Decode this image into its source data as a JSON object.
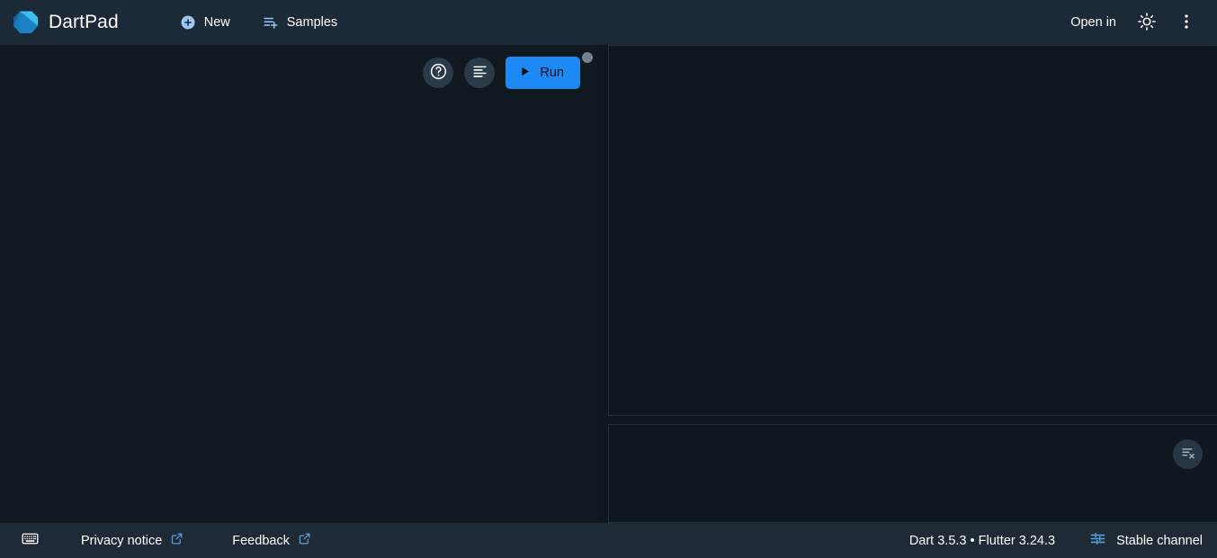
{
  "app": {
    "title": "DartPad",
    "logo_icon": "dart-logo-icon",
    "accent_blue": "#1d89f5",
    "topbar_bg": "#1c2936",
    "editor_bg": "#101820",
    "panel_bg": "#0f1720",
    "statusbar_bg": "#1e2b37"
  },
  "topbar": {
    "nav": [
      {
        "label": "New",
        "icon": "add-circle-icon"
      },
      {
        "label": "Samples",
        "icon": "playlist-add-icon"
      }
    ],
    "open_in": {
      "label": "Open in",
      "icon": "download-icon"
    },
    "theme_toggle": {
      "icon": "brightness-sun-icon",
      "label": ""
    },
    "overflow_menu": {
      "icon": "more-vert-icon",
      "label": ""
    }
  },
  "editor": {
    "toolbar": {
      "help": {
        "icon": "help-circle-icon",
        "label": ""
      },
      "format": {
        "icon": "format-align-icon",
        "label": ""
      },
      "run": {
        "label": "Run",
        "icon": "play-arrow-icon"
      },
      "status_indicator": {
        "icon": "status-dot-icon",
        "color": "#76818c"
      }
    },
    "content": ""
  },
  "preview": {
    "content": ""
  },
  "console": {
    "content": "",
    "clear_button": {
      "icon": "format-clear-icon",
      "label": ""
    }
  },
  "statusbar": {
    "keyboard_shortcuts": {
      "icon": "keyboard-icon",
      "label": ""
    },
    "links": [
      {
        "label": "Privacy notice",
        "icon": "open-in-new-icon"
      },
      {
        "label": "Feedback",
        "icon": "open-in-new-icon"
      }
    ],
    "version": "Dart 3.5.3 • Flutter 3.24.3",
    "channel": {
      "label": "Stable channel",
      "icon": "tune-icon"
    }
  }
}
